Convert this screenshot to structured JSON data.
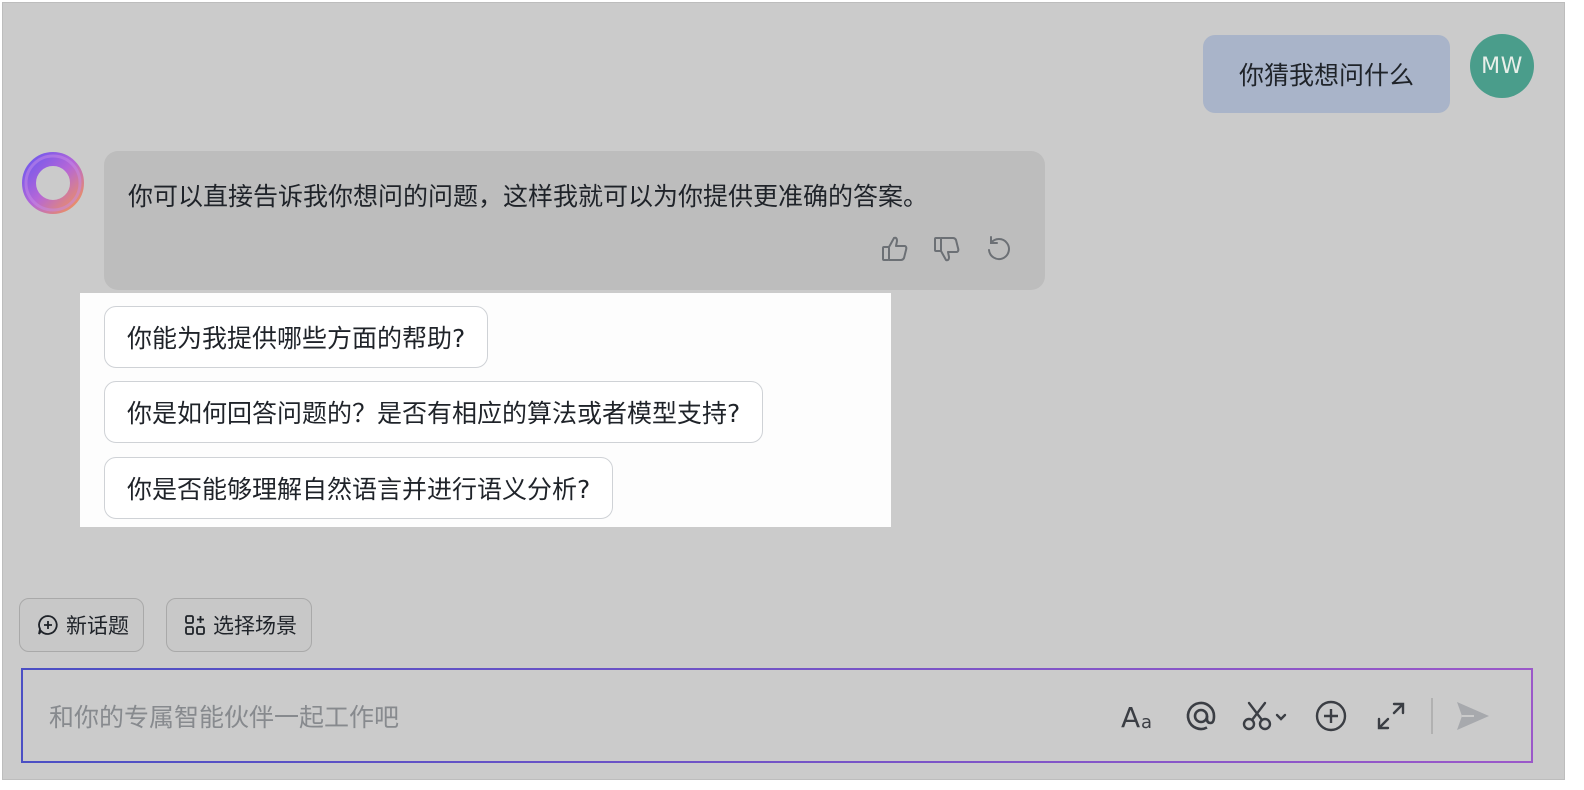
{
  "conversation": {
    "user_message": "你猜我想问什么",
    "user_avatar_initials": "MW",
    "bot_message": "你可以直接告诉我你想问的问题，这样我就可以为你提供更准确的答案。"
  },
  "suggestions": [
    "你能为我提供哪些方面的帮助?",
    "你是如何回答问题的？是否有相应的算法或者模型支持?",
    "你是否能够理解自然语言并进行语义分析?"
  ],
  "toolbar": {
    "new_topic_label": "新话题",
    "select_scene_label": "选择场景"
  },
  "input": {
    "placeholder": "和你的专属智能伙伴一起工作吧",
    "value": ""
  },
  "icons": {
    "like": "thumbs-up-icon",
    "dislike": "thumbs-down-icon",
    "regenerate": "refresh-icon",
    "format": "text-format-icon",
    "mention": "at-icon",
    "screenshot": "scissors-icon",
    "add": "plus-circle-icon",
    "expand": "expand-icon",
    "send": "send-icon"
  },
  "colors": {
    "user_bubble": "#a9b4c9",
    "avatar": "#4a9d8b",
    "input_border_start": "#4b4fc4",
    "input_border_end": "#9b58c9"
  }
}
